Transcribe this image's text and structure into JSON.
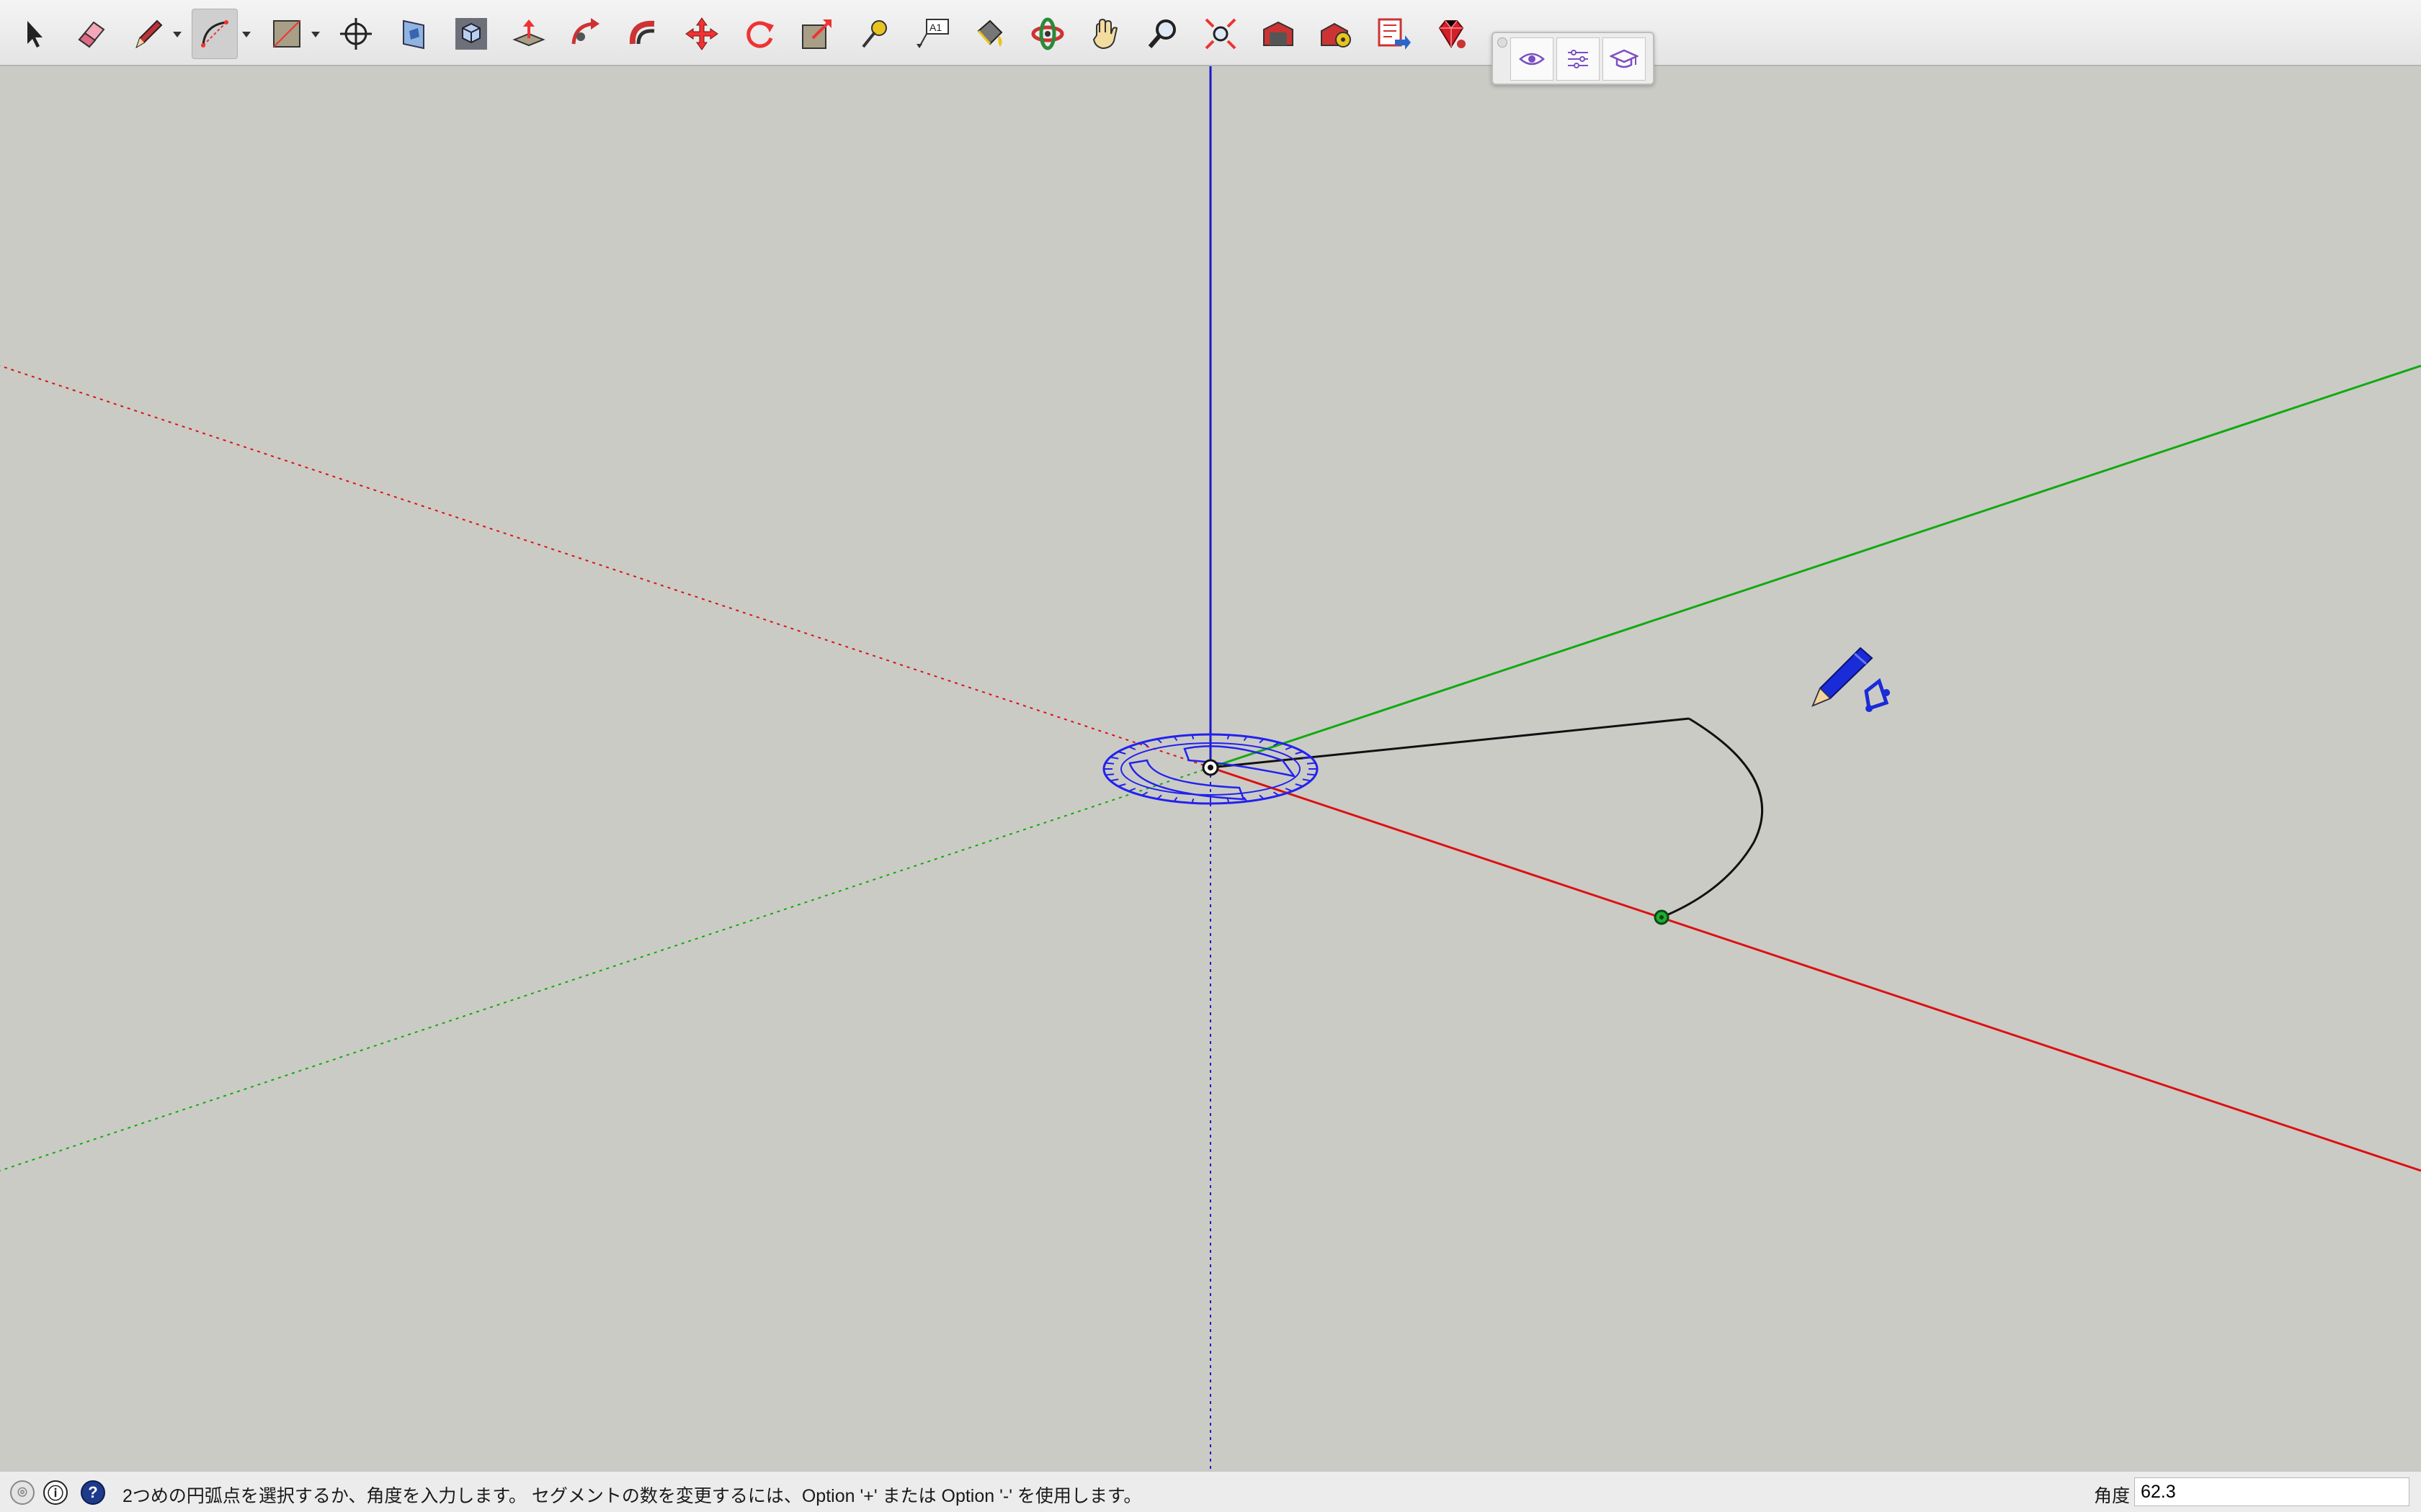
{
  "toolbar": {
    "tools": [
      {
        "name": "select-tool",
        "icon": "arrow-cursor-icon"
      },
      {
        "name": "eraser-tool",
        "icon": "eraser-icon"
      },
      {
        "name": "line-tool",
        "icon": "pencil-icon"
      },
      {
        "name": "arc-tool",
        "icon": "arc-icon",
        "active": true
      },
      {
        "name": "rectangle-tool",
        "icon": "rectangle-icon"
      },
      {
        "name": "tape-measure-tool",
        "icon": "crosshair-icon"
      },
      {
        "name": "section-plane-tool",
        "icon": "section-plane-icon"
      },
      {
        "name": "iso-view-tool",
        "icon": "iso-cube-icon"
      },
      {
        "name": "push-pull-tool",
        "icon": "push-pull-icon"
      },
      {
        "name": "follow-me-tool",
        "icon": "follow-me-icon"
      },
      {
        "name": "offset-tool",
        "icon": "offset-icon"
      },
      {
        "name": "move-tool",
        "icon": "move-arrows-icon"
      },
      {
        "name": "rotate-tool",
        "icon": "rotate-icon"
      },
      {
        "name": "scale-tool",
        "icon": "scale-icon"
      },
      {
        "name": "tape-measure-2-tool",
        "icon": "tape-measure-icon"
      },
      {
        "name": "text-tool",
        "icon": "text-icon",
        "label": "A1"
      },
      {
        "name": "paint-bucket-tool",
        "icon": "paint-bucket-icon"
      },
      {
        "name": "orbit-tool",
        "icon": "orbit-icon"
      },
      {
        "name": "pan-tool",
        "icon": "hand-icon"
      },
      {
        "name": "zoom-tool",
        "icon": "magnifier-icon"
      },
      {
        "name": "zoom-extents-tool",
        "icon": "zoom-extents-icon"
      },
      {
        "name": "warehouse-tool",
        "icon": "warehouse-icon"
      },
      {
        "name": "extension-warehouse-tool",
        "icon": "extension-icon"
      },
      {
        "name": "layout-send-tool",
        "icon": "send-to-layout-icon"
      },
      {
        "name": "ruby-console-tool",
        "icon": "ruby-gem-icon"
      }
    ],
    "panel_buttons": [
      "eye-icon",
      "sliders-icon",
      "graduation-cap-icon"
    ]
  },
  "status": {
    "message": "2つめの円弧点を選択するか、角度を入力します。 セグメントの数を変更するには、Option '+' または Option '-' を使用します。",
    "angle_label": "角度",
    "angle_value": "62.3"
  },
  "colors": {
    "background": "#cbcbc6",
    "red_axis": "#dd1111",
    "green_axis": "#11aa11",
    "blue_axis": "#1a1acc",
    "protractor": "#2222ee"
  }
}
